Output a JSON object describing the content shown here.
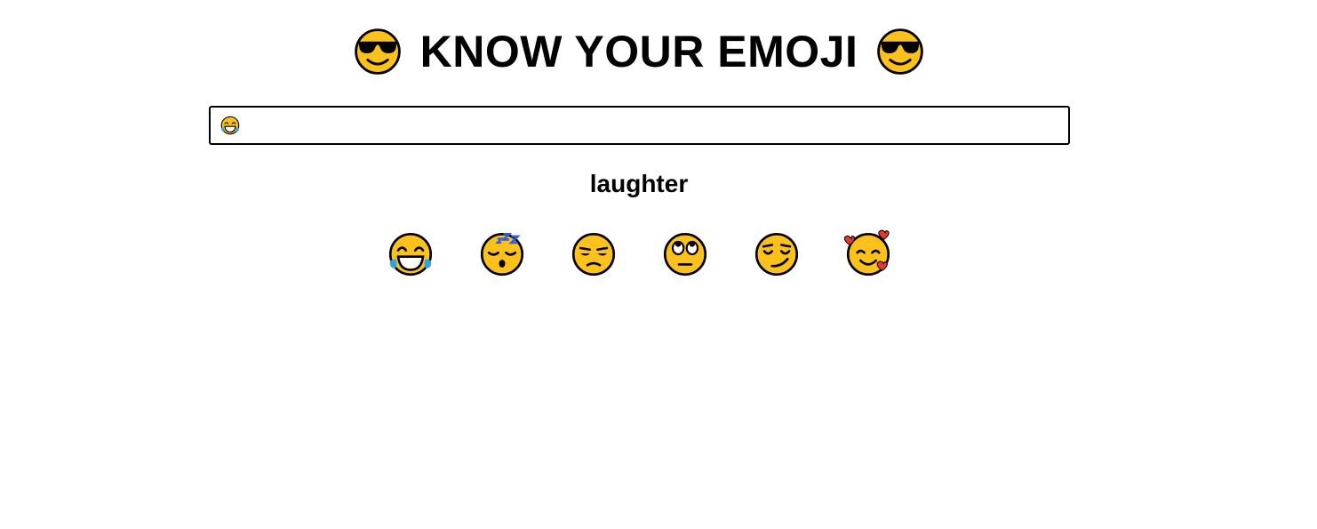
{
  "header": {
    "title": "KNOW YOUR EMOJI",
    "left_icon": "smiling-face-with-sunglasses-icon",
    "right_icon": "smiling-face-with-sunglasses-icon"
  },
  "search": {
    "value_icon": "face-with-tears-of-joy-icon",
    "placeholder": ""
  },
  "result": {
    "meaning": "laughter"
  },
  "emoji_list": [
    {
      "name": "face-with-tears-of-joy-icon"
    },
    {
      "name": "sleeping-face-icon"
    },
    {
      "name": "unamused-face-icon"
    },
    {
      "name": "face-with-rolling-eyes-icon"
    },
    {
      "name": "smirking-face-icon"
    },
    {
      "name": "smiling-face-with-hearts-icon"
    }
  ],
  "colors": {
    "emoji_face": "#FCC21B",
    "outline": "#000000",
    "tears": "#2FA3E6",
    "zzz": "#2F5BE6",
    "hearts": "#E8392A"
  }
}
